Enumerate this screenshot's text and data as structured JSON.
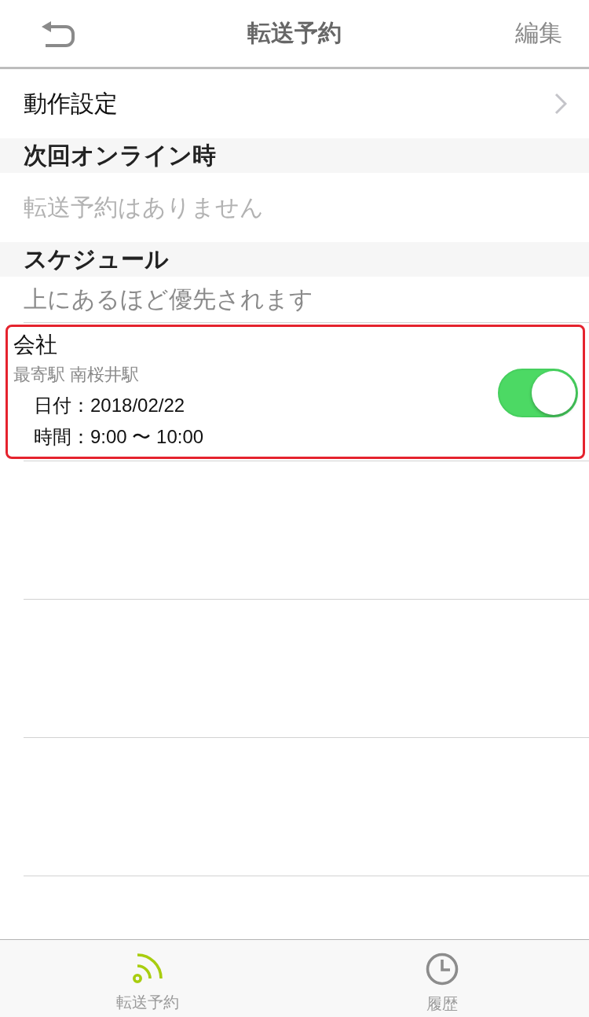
{
  "nav_bar": {
    "title": "転送予約",
    "edit_button": "編集"
  },
  "action_settings": {
    "label": "動作設定"
  },
  "next_online": {
    "header": "次回オンライン時",
    "empty_message": "転送予約はありません"
  },
  "schedule": {
    "header": "スケジュール",
    "hint": "上にあるほど優先されます",
    "items": [
      {
        "name": "会社",
        "station": "最寄駅 南桜井駅",
        "date": "日付：2018/02/22",
        "time": "時間：9:00 〜 10:00",
        "on": true,
        "highlighted": true
      }
    ]
  },
  "tab_bar": {
    "tabs": [
      {
        "label": "転送予約",
        "kind": "feed",
        "selected": true
      },
      {
        "label": "履歴",
        "kind": "clock",
        "selected": false
      }
    ]
  }
}
